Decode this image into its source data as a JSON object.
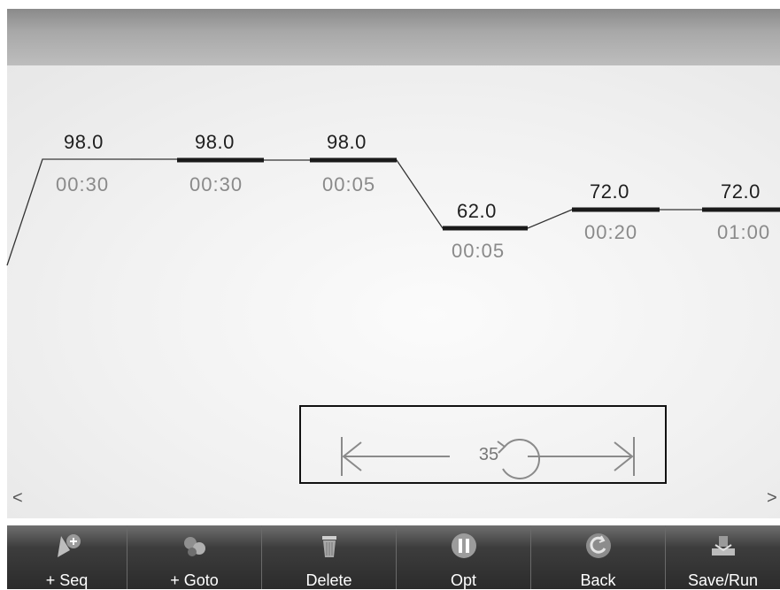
{
  "steps": [
    {
      "temp": "98.0",
      "time": "00:30"
    },
    {
      "temp": "98.0",
      "time": "00:30"
    },
    {
      "temp": "98.0",
      "time": "00:05"
    },
    {
      "temp": "62.0",
      "time": "00:05"
    },
    {
      "temp": "72.0",
      "time": "00:20"
    },
    {
      "temp": "72.0",
      "time": "01:00"
    }
  ],
  "loop": {
    "cycles": "35"
  },
  "nav": {
    "prev": "<",
    "next": ">"
  },
  "toolbar": [
    {
      "label": "+ Seq",
      "icon": "add-sequence-icon"
    },
    {
      "label": "+ Goto",
      "icon": "add-goto-icon"
    },
    {
      "label": "Delete",
      "icon": "trash-icon"
    },
    {
      "label": "Opt",
      "icon": "pause-icon"
    },
    {
      "label": "Back",
      "icon": "back-icon"
    },
    {
      "label": "Save/Run",
      "icon": "save-run-icon"
    }
  ],
  "colors": {
    "toolbar": "#2b2b2b",
    "header": "#9c9c9c",
    "plateau": "#1a1a1a"
  }
}
